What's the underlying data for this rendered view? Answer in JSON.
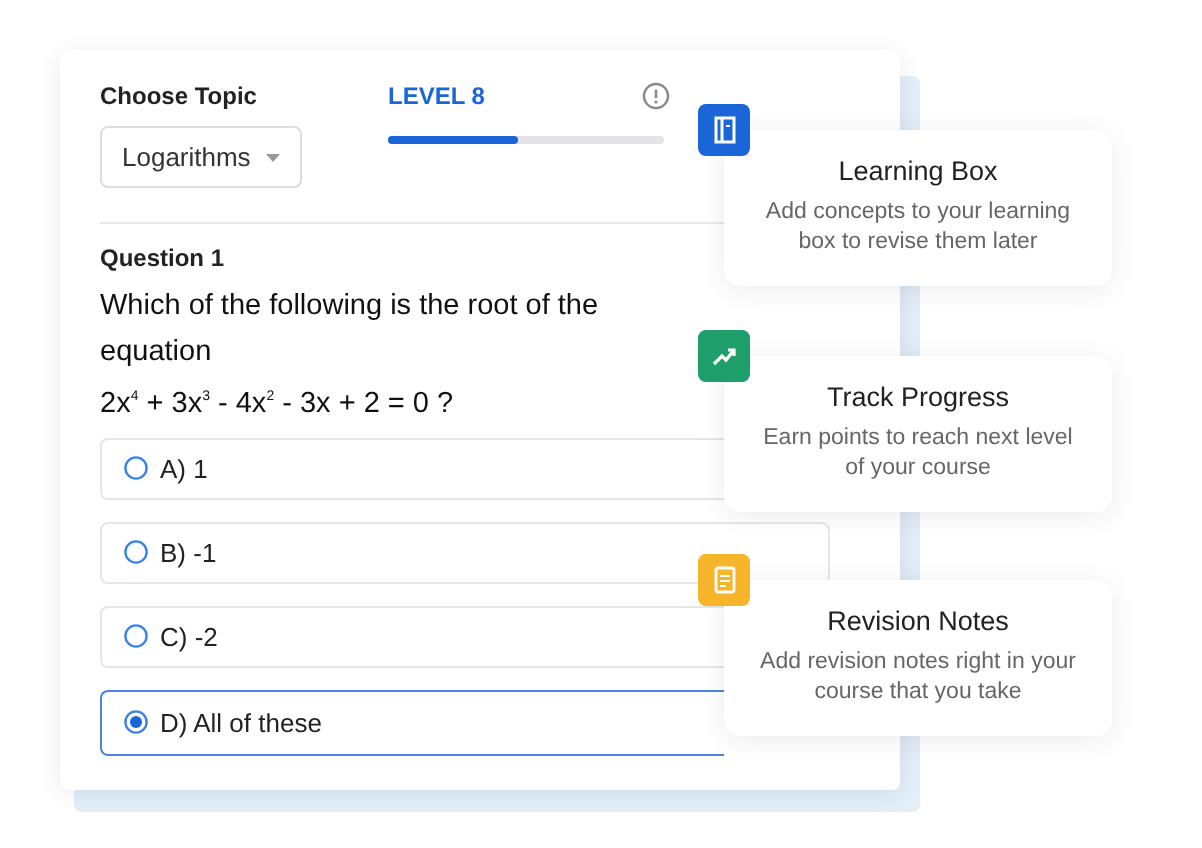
{
  "topic": {
    "label": "Choose Topic",
    "value": "Logarithms"
  },
  "level": {
    "label": "LEVEL 8",
    "level": 0.47
  },
  "question": {
    "label": "Question 1",
    "text": "Which of the following is the root of the equation",
    "equation": "2x$^{4}$ + 3x$^{3}$ - 4x$^{2}$ - 3x + 2 = 0 ?"
  },
  "options": [
    {
      "label": "A) 1",
      "selected": false
    },
    {
      "label": "B) -1",
      "selected": false
    },
    {
      "label": "C) -2",
      "selected": false
    },
    {
      "label": "D) All of these",
      "selected": true
    }
  ],
  "features": [
    {
      "kind": "book",
      "color": "#1a66d9",
      "title": "Learning Box",
      "text": "Add concepts to your learning box to revise them later"
    },
    {
      "kind": "trend",
      "color": "#1e9e6a",
      "title": "Track Progress",
      "text": "Earn points to reach next level of your course"
    },
    {
      "kind": "notes",
      "color": "#f7b52c",
      "title": "Revision Notes",
      "text": "Add revision notes right in your course that you take"
    }
  ]
}
